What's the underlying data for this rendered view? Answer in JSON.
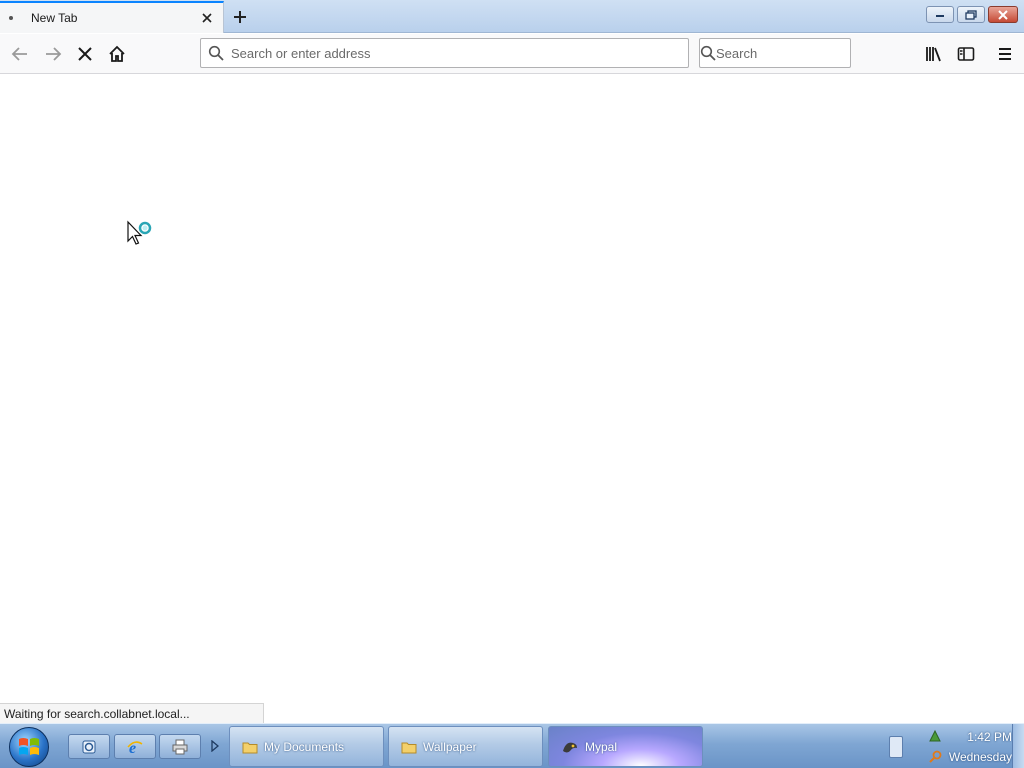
{
  "window": {
    "tab": {
      "title": "New Tab"
    },
    "controls": {
      "minimize": "minimize",
      "restore": "restore",
      "close": "close"
    }
  },
  "toolbar": {
    "url_placeholder": "Search or enter address",
    "search_placeholder": "Search",
    "icons": [
      "back-icon",
      "forward-icon",
      "stop-icon",
      "home-icon",
      "library-icon",
      "sidebar-icon",
      "menu-icon"
    ]
  },
  "status": {
    "text": "Waiting for search.collabnet.local..."
  },
  "taskbar": {
    "items": [
      {
        "label": "My Documents",
        "icon": "folder-icon"
      },
      {
        "label": "Wallpaper",
        "icon": "folder-icon"
      },
      {
        "label": "Mypal",
        "icon": "mypal-icon"
      }
    ],
    "clock": {
      "time": "1:42 PM",
      "day": "Wednesday"
    }
  },
  "colors": {
    "accent": "#0a84ff",
    "taskbar": "#7fa6d3",
    "close_button": "#c54a35"
  }
}
